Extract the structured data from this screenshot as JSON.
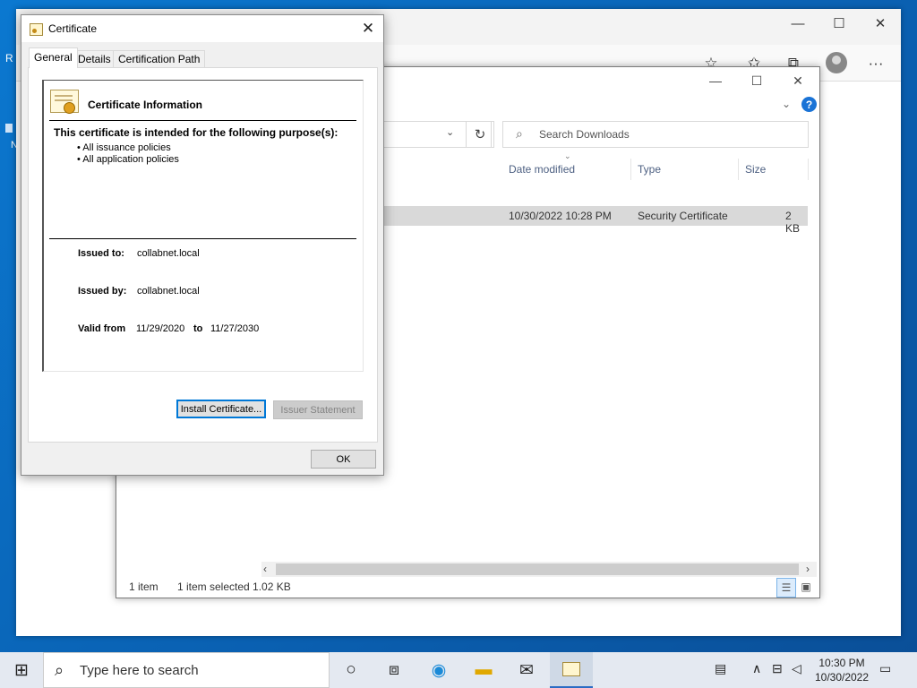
{
  "certificate": {
    "title": "Certificate",
    "tabs": [
      "General",
      "Details",
      "Certification Path"
    ],
    "info_heading": "Certificate Information",
    "purpose_heading": "This certificate is intended for the following purpose(s):",
    "purposes": [
      "• All issuance policies",
      "• All application policies"
    ],
    "issued_to_label": "Issued to:",
    "issued_to": "collabnet.local",
    "issued_by_label": "Issued by:",
    "issued_by": "collabnet.local",
    "valid_from_label": "Valid from",
    "valid_from": "11/29/2020",
    "to_label": "to",
    "valid_to": "11/27/2030",
    "install_button": "Install Certificate...",
    "issuer_button": "Issuer Statement",
    "ok_button": "OK"
  },
  "explorer": {
    "search_placeholder": "Search Downloads",
    "columns": [
      "Date modified",
      "Type",
      "Size"
    ],
    "row": {
      "date": "10/30/2022 10:28 PM",
      "type": "Security Certificate",
      "size": "2 KB"
    },
    "status_items": "1 item",
    "status_selected": "1 item selected  1.02 KB"
  },
  "taskbar": {
    "search_placeholder": "Type here to search",
    "time": "10:30 PM",
    "date": "10/30/2022"
  },
  "desktop": {
    "label_r": "R",
    "label_n": "N"
  }
}
